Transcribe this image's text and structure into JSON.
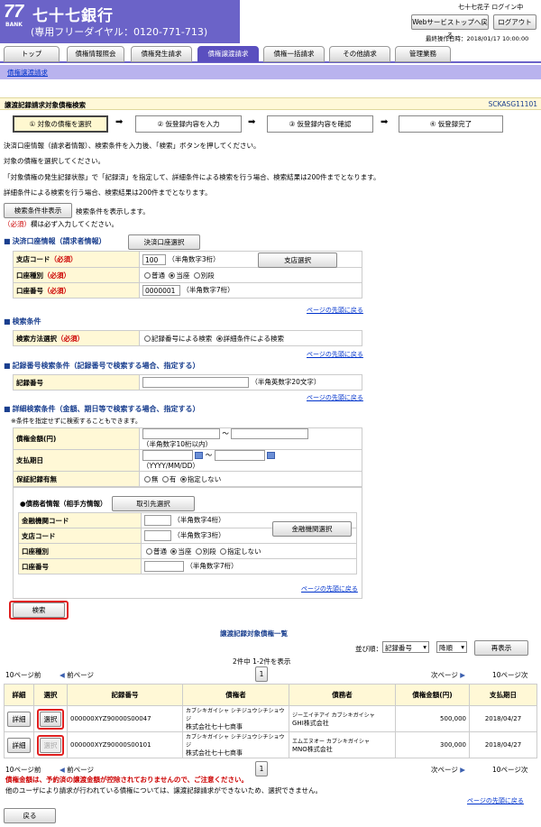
{
  "header": {
    "logo_number": "77",
    "logo_bank": "BANK",
    "bank_name": "七十七銀行",
    "toll_free": "(専用フリーダイヤル：0120-771-713)",
    "user_status": "七十七花子 ログイン中",
    "back_to_top_button": "Webサービストップへ戻る",
    "logout_button": "ログアウト",
    "last_operation": "最終操作日時：2018/01/17 10:00:00"
  },
  "tabs": [
    "トップ",
    "債権情報照会",
    "債権発生請求",
    "債権譲渡請求",
    "債権一括請求",
    "その他請求",
    "管理業務"
  ],
  "subnav": "債権譲渡請求",
  "page": {
    "title": "譲渡記録請求対象債権検索",
    "screen_id": "SCKASG11101"
  },
  "steps": [
    "① 対象の債権を選択",
    "② 仮登録内容を入力",
    "③ 仮登録内容を確認",
    "④ 仮登録完了"
  ],
  "instructions": [
    "決済口座情報（請求者情報）、検索条件を入力後、「検索」ボタンを押してください。",
    "対象の債権を選択してください。",
    "「対象債権の発生記録状態」で「記録済」を指定して、詳細条件による検索を行う場合、検索結果は200件までとなります。",
    "詳細条件による検索を行う場合、検索結果は200件までとなります。"
  ],
  "search_toggle": {
    "button": "検索条件非表示",
    "note": "検索条件を表示します。"
  },
  "required_note": {
    "mark": "（必須）",
    "text": "欄は必ず入力してください。"
  },
  "settlement": {
    "section_title": "決済口座情報（請求者情報）",
    "select_button": "決済口座選択",
    "branch_label": "支店コード",
    "branch_value": "100",
    "branch_hint": "（半角数字3桁）",
    "branch_select_button": "支店選択",
    "account_type_label": "口座種別",
    "account_type_options": [
      "普通",
      "当座",
      "別段"
    ],
    "account_type_selected": "当座",
    "account_number_label": "口座番号",
    "account_number_value": "0000001",
    "account_number_hint": "（半角数字7桁）",
    "required": "（必須）"
  },
  "search_method": {
    "section_title": "検索条件",
    "label": "検索方法選択",
    "required": "（必須）",
    "options": [
      "記録番号による検索",
      "詳細条件による検索"
    ],
    "selected": "詳細条件による検索"
  },
  "record_search": {
    "section_title": "記録番号検索条件（記録番号で検索する場合、指定する）",
    "label": "記録番号",
    "hint": "（半角英数字20文字）"
  },
  "detail_search": {
    "section_title": "詳細検索条件（金額、期日等で検索する場合、指定する）",
    "note": "※条件を指定せずに検索することもできます。",
    "amount_label": "債権金額(円)",
    "amount_hint": "（半角数字10桁以内）",
    "due_label": "支払期日",
    "due_hint": "（YYYY/MM/DD）",
    "tilde": "～",
    "guarantee_label": "保証記録有無",
    "guarantee_options": [
      "無",
      "有",
      "指定しない"
    ],
    "guarantee_selected": "指定しない",
    "debtor_title": "●債務者情報（相手方情報）",
    "partner_button": "取引先選択",
    "bank_code_label": "金融機関コード",
    "bank_code_hint": "（半角数字4桁）",
    "bank_select_button": "金融機関選択",
    "debtor_branch_label": "支店コード",
    "debtor_branch_hint": "（半角数字3桁）",
    "debtor_account_type_label": "口座種別",
    "debtor_account_type_options": [
      "普通",
      "当座",
      "別段",
      "指定しない"
    ],
    "debtor_account_type_selected": "当座",
    "debtor_account_number_label": "口座番号",
    "debtor_account_number_hint": "（半角数字7桁）"
  },
  "pagetop_link": "ページの先頭に戻る",
  "search_button": "検索",
  "results": {
    "title": "譲渡記録対象債権一覧",
    "sort_label": "並び順：",
    "sort_field": "記録番号",
    "sort_order": "降順",
    "resort_button": "再表示",
    "count_text": "2件中 1-2件を表示",
    "prev10": "10ページ前",
    "prev": "前ページ",
    "page": "1",
    "next": "次ページ",
    "next10": "10ページ次",
    "columns": [
      "詳細",
      "選択",
      "記録番号",
      "債権者",
      "債務者",
      "債権金額(円)",
      "支払期日"
    ],
    "rows": [
      {
        "detail": "詳細",
        "select": "選択",
        "record_no": "000000XYZ90000S00047",
        "creditor_kana": "カブシキガイシャ シチジュウシチショウジ",
        "creditor": "株式会社七十七商事",
        "debtor_kana": "ジーエイチアイ カブシキガイシャ",
        "debtor": "GHI株式会社",
        "amount": "500,000",
        "due": "2018/04/27"
      },
      {
        "detail": "詳細",
        "select": "選択",
        "record_no": "000000XYZ90000S00101",
        "creditor_kana": "カブシキガイシャ シチジュウシチショウジ",
        "creditor": "株式会社七十七商事",
        "debtor_kana": "エムエヌオー カブシキガイシャ",
        "debtor": "MNO株式会社",
        "amount": "300,000",
        "due": "2018/04/27"
      }
    ],
    "warning": "債権金額は、予約済の譲渡金額が控除されておりませんので、ご注意ください。",
    "footer_note": "他のユーザにより請求が行われている債権については、譲渡記録請求ができないため、選択できません。"
  },
  "back_button": "戻る",
  "colors": {
    "brand": "#6b63c8",
    "active_tab": "#5a4fbf",
    "label_bg": "#fff8d6",
    "highlight_red": "#e02020"
  }
}
